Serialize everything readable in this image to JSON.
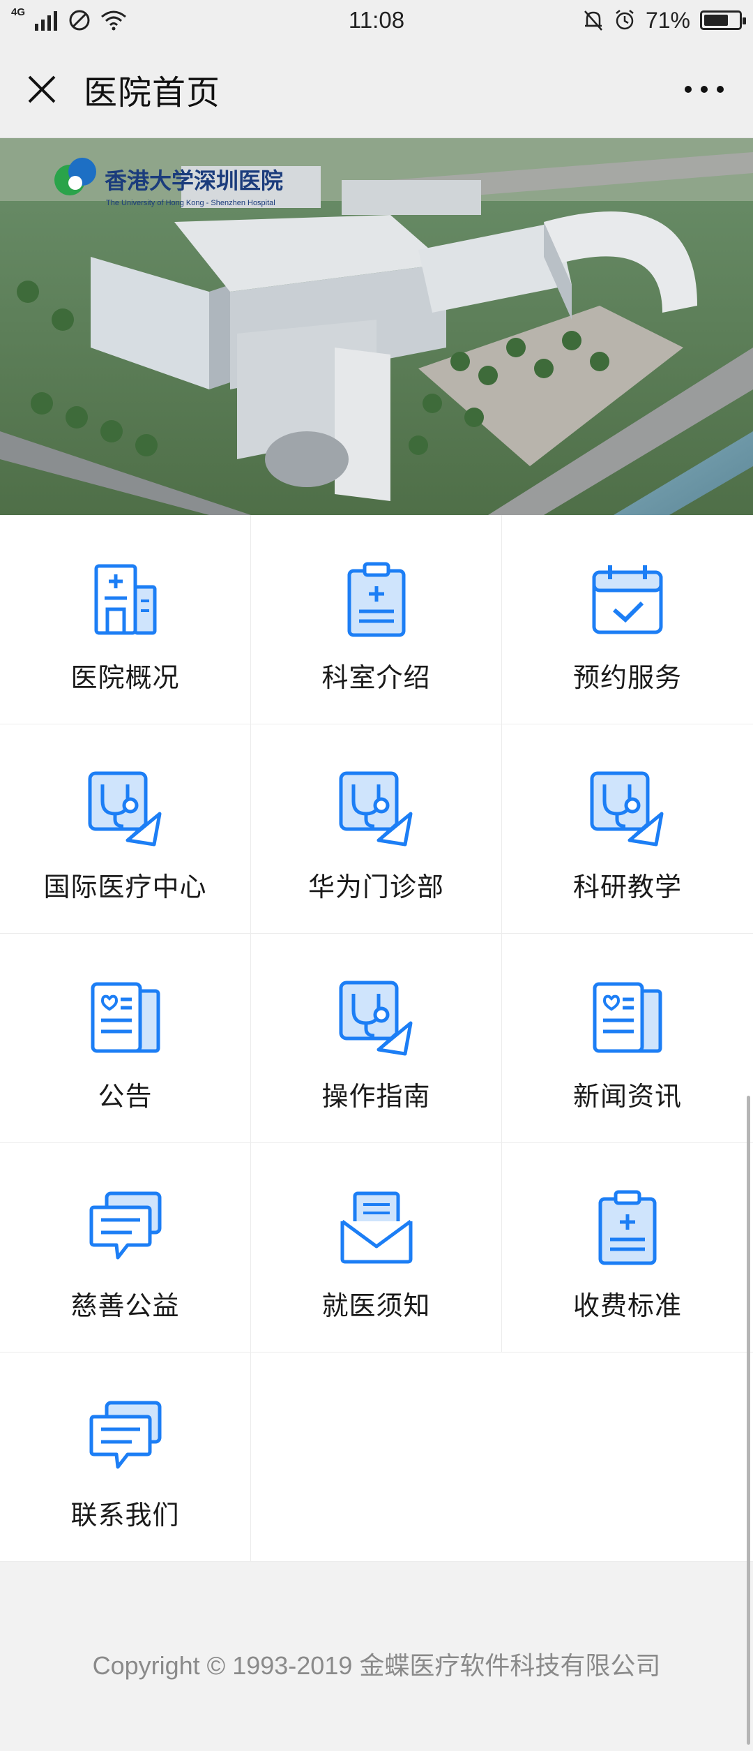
{
  "status_bar": {
    "network": "4G",
    "time": "11:08",
    "battery": "71%",
    "battery_level": 0.71
  },
  "header": {
    "title": "医院首页"
  },
  "banner": {
    "hospital_name": "香港大学深圳医院",
    "hospital_name_en": "The University of Hong Kong - Shenzhen Hospital"
  },
  "menu": [
    {
      "label": "医院概况",
      "icon": "hospital-building-icon"
    },
    {
      "label": "科室介绍",
      "icon": "clipboard-icon"
    },
    {
      "label": "预约服务",
      "icon": "calendar-check-icon"
    },
    {
      "label": "国际医疗中心",
      "icon": "stethoscope-icon"
    },
    {
      "label": "华为门诊部",
      "icon": "stethoscope-icon"
    },
    {
      "label": "科研教学",
      "icon": "stethoscope-icon"
    },
    {
      "label": "公告",
      "icon": "health-document-icon"
    },
    {
      "label": "操作指南",
      "icon": "stethoscope-icon"
    },
    {
      "label": "新闻资讯",
      "icon": "health-document-icon"
    },
    {
      "label": "慈善公益",
      "icon": "chat-bubble-icon"
    },
    {
      "label": "就医须知",
      "icon": "envelope-icon"
    },
    {
      "label": "收费标准",
      "icon": "clipboard-icon"
    },
    {
      "label": "联系我们",
      "icon": "chat-bubble-icon"
    }
  ],
  "footer": {
    "copyright": "Copyright © 1993-2019 金蝶医疗软件科技有限公司"
  },
  "colors": {
    "icon_blue": "#1c7ef5",
    "icon_fill": "#cfe4fc"
  }
}
